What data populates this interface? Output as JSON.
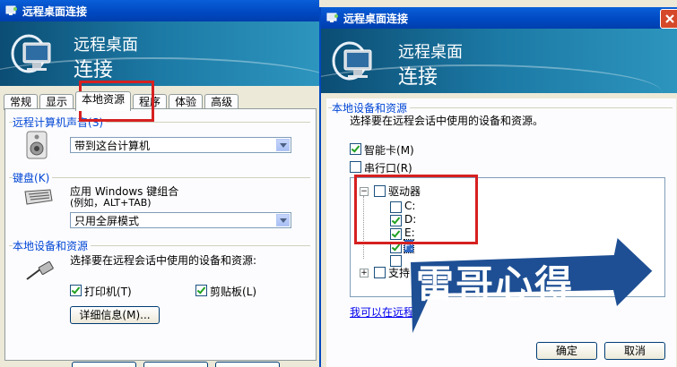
{
  "left_window": {
    "title": "远程桌面连接",
    "banner_line1": "远程桌面",
    "banner_line2": "连接",
    "tabs": [
      "常规",
      "显示",
      "本地资源",
      "程序",
      "体验",
      "高级"
    ],
    "active_tab": "本地资源",
    "sound_group_label": "远程计算机声音",
    "sound_shortcut": "(S)",
    "sound_value": "带到这台计算机",
    "keyboard_group_label": "键盘",
    "keyboard_shortcut": "(K)",
    "keyboard_desc_line1": "应用 Windows 键组合",
    "keyboard_desc_line2": "(例如，ALT+TAB)",
    "keyboard_value": "只用全屏模式",
    "devices_group_label": "本地设备和资源",
    "devices_desc": "选择要在远程会话中使用的设备和资源:",
    "printer_label": "打印机",
    "printer_shortcut": "(T)",
    "printer_checked": true,
    "clipboard_label": "剪贴板",
    "clipboard_shortcut": "(L)",
    "clipboard_checked": true,
    "details_button": "详细信息",
    "details_shortcut": "(M)..."
  },
  "right_window": {
    "title": "远程桌面连接",
    "banner_line1": "远程桌面",
    "banner_line2": "连接",
    "group_label": "本地设备和资源",
    "desc": "选择要在远程会话中使用的设备和资源。",
    "smartcard_label": "智能卡",
    "smartcard_shortcut": "(M)",
    "smartcard_checked": true,
    "serial_label": "串行口",
    "serial_shortcut": "(R)",
    "serial_checked": false,
    "tree": {
      "drives_label": "驱动器",
      "drives": [
        {
          "label": "C:",
          "checked": false
        },
        {
          "label": "D:",
          "checked": true
        },
        {
          "label": "E:",
          "checked": true
        },
        {
          "label": "F:",
          "checked": true
        }
      ],
      "supported_label": "支持"
    },
    "link_text": "我可以在远程",
    "ok_button": "确定",
    "cancel_button": "取消"
  },
  "watermark": {
    "text": "雷哥心得",
    "color": "#1e4f94"
  },
  "colors": {
    "titlebar": "#0048c0",
    "highlight_box": "#d62020",
    "group_label": "#0046d5"
  }
}
